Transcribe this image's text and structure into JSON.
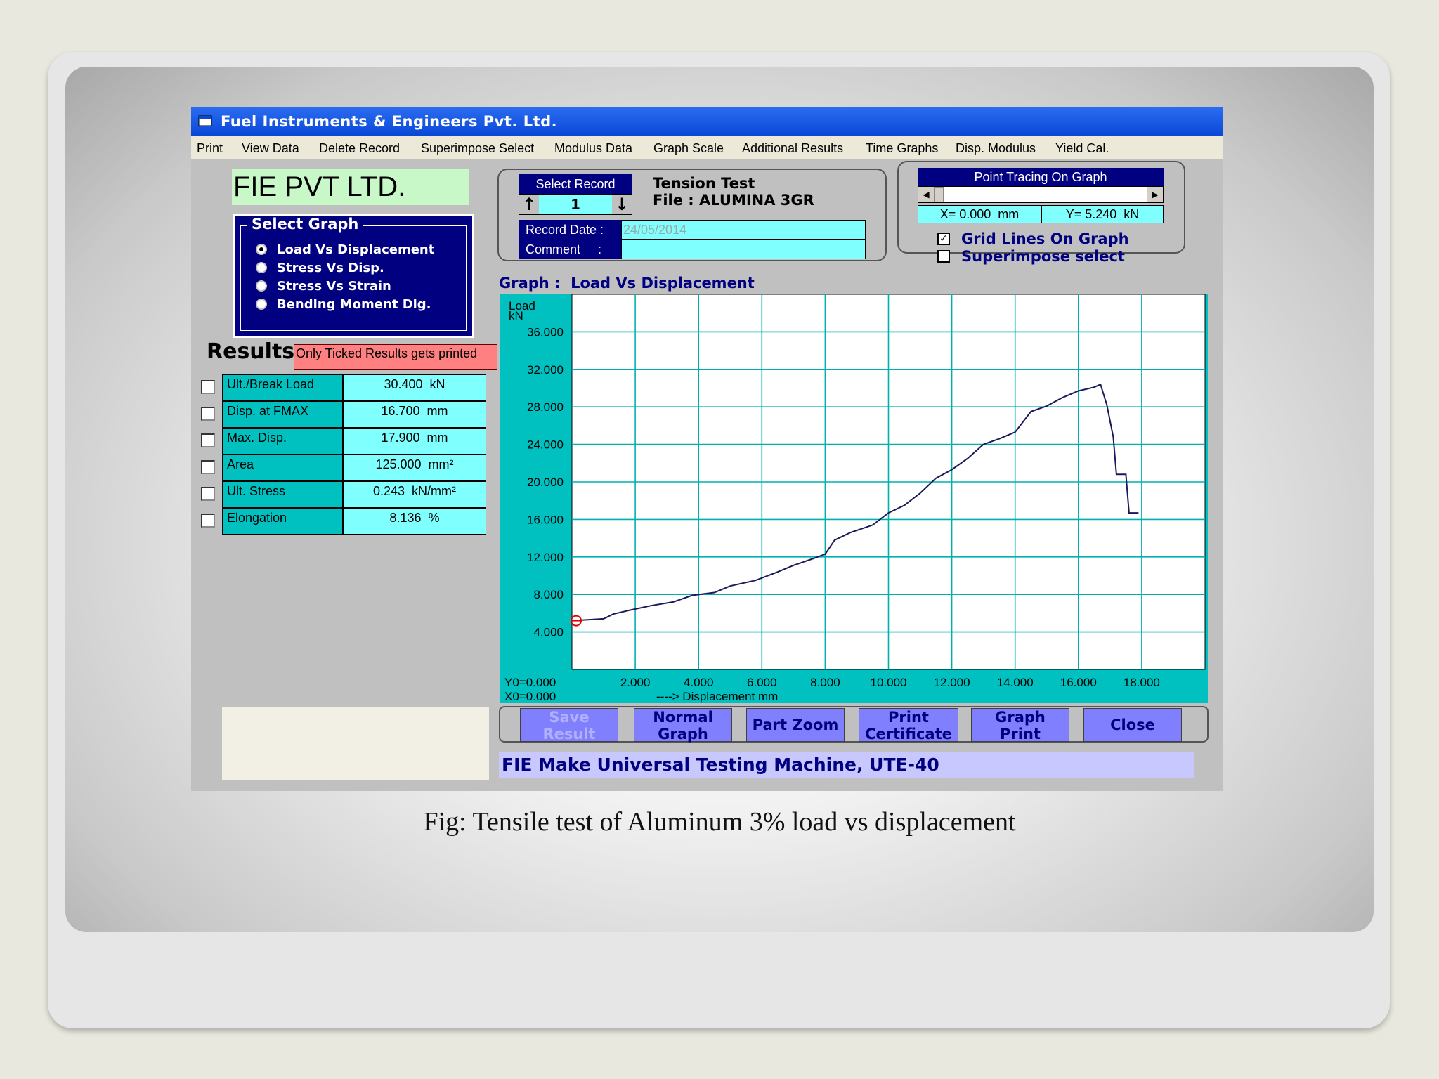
{
  "window": {
    "title": "Fuel Instruments & Engineers Pvt. Ltd."
  },
  "menu": [
    "Print",
    "View Data",
    "Delete Record",
    "Superimpose Select",
    "Modulus Data",
    "Graph Scale",
    "Additional Results",
    "Time Graphs",
    "Disp. Modulus",
    "Yield Cal."
  ],
  "logo_text": "FIE PVT LTD.",
  "select_graph": {
    "title": "Select Graph",
    "options": [
      "Load Vs Displacement",
      "Stress Vs Disp.",
      "Stress Vs Strain",
      "Bending Moment Dig."
    ],
    "selected_index": 0
  },
  "results": {
    "title": "Results",
    "note": "Only Ticked Results gets printed",
    "rows": [
      {
        "label": "Ult./Break Load",
        "value": "30.400  kN",
        "checked": false
      },
      {
        "label": "Disp. at FMAX",
        "value": "16.700  mm",
        "checked": false
      },
      {
        "label": "Max. Disp.",
        "value": "17.900  mm",
        "checked": false
      },
      {
        "label": "Area",
        "value": "125.000  mm²",
        "checked": false
      },
      {
        "label": "Ult. Stress",
        "value": "0.243  kN/mm²",
        "checked": false
      },
      {
        "label": "Elongation",
        "value": "8.136  %",
        "checked": false
      }
    ]
  },
  "record": {
    "select_label": "Select Record",
    "number": "1",
    "test_type": "Tension Test",
    "file": "File : ALUMINA 3GR",
    "date_label": "Record Date :",
    "date_value": "24/05/2014",
    "comment_label": "Comment     :",
    "comment_value": ""
  },
  "point_tracing": {
    "title": "Point Tracing On Graph",
    "x_text": "X= 0.000  mm",
    "y_text": "Y= 5.240  kN",
    "slider_fraction": 0.0
  },
  "options": {
    "grid_lines": {
      "label": "Grid Lines On Graph",
      "checked": true
    },
    "superimpose": {
      "label": "Superimpose select",
      "checked": false
    }
  },
  "graph_title": "Graph :  Load Vs Displacement",
  "chart_data": {
    "type": "line",
    "title": "Graph :  Load Vs Displacement",
    "ylabel": "Load",
    "yunit": "kN",
    "xlabel": "----> Displacement  mm",
    "xlim": [
      0,
      20
    ],
    "ylim": [
      0,
      40
    ],
    "x_ticks": [
      "2.000",
      "4.000",
      "6.000",
      "8.000",
      "10.000",
      "12.000",
      "14.000",
      "16.000",
      "18.000"
    ],
    "y_ticks": [
      "4.000",
      "8.000",
      "12.000",
      "16.000",
      "20.000",
      "24.000",
      "28.000",
      "32.000",
      "36.000"
    ],
    "origin_labels": [
      "Y0=0.000",
      "X0=0.000"
    ],
    "grid": true,
    "colors": {
      "grid": "#00b0b0",
      "line": "#1a1a5a",
      "marker": "#e00000"
    },
    "series": [
      {
        "x": [
          0.0,
          0.5,
          1.0,
          1.3,
          1.8,
          2.5,
          3.2,
          3.8,
          4.5,
          5.0,
          5.8,
          6.5,
          7.0,
          7.6,
          8.0,
          8.3,
          8.8,
          9.5,
          10.0,
          10.5,
          11.0,
          11.5,
          12.0,
          12.5,
          13.0,
          13.5,
          14.0,
          14.5,
          15.0,
          15.5,
          16.0,
          16.5,
          16.7,
          16.9,
          17.1,
          17.2,
          17.5,
          17.6,
          17.9
        ],
        "y": [
          5.2,
          5.3,
          5.4,
          5.9,
          6.3,
          6.8,
          7.2,
          7.9,
          8.2,
          8.9,
          9.5,
          10.4,
          11.1,
          11.8,
          12.3,
          13.8,
          14.6,
          15.4,
          16.7,
          17.5,
          18.8,
          20.4,
          21.3,
          22.5,
          24.0,
          24.6,
          25.3,
          27.5,
          28.1,
          29.0,
          29.7,
          30.1,
          30.4,
          28.2,
          24.8,
          20.8,
          20.8,
          16.7,
          16.7
        ]
      }
    ]
  },
  "buttons": [
    {
      "label": "Save\nResult",
      "enabled": false
    },
    {
      "label": "Normal\nGraph",
      "enabled": true
    },
    {
      "label": "Part Zoom",
      "enabled": true
    },
    {
      "label": "Print\nCertificate",
      "enabled": true
    },
    {
      "label": "Graph\nPrint",
      "enabled": true
    },
    {
      "label": "Close",
      "enabled": true
    }
  ],
  "status_text": "FIE Make Universal Testing Machine, UTE-40",
  "caption": "Fig: Tensile test of Aluminum 3% load vs displacement",
  "colors": {
    "title_bar": "#0a48d8",
    "panel_navy": "#000080",
    "cyan_field": "#80ffff",
    "teal_field": "#00c0c0",
    "button_fill": "#8080ff",
    "note_red": "#ff8080",
    "logo_green": "#c8f8c8"
  }
}
